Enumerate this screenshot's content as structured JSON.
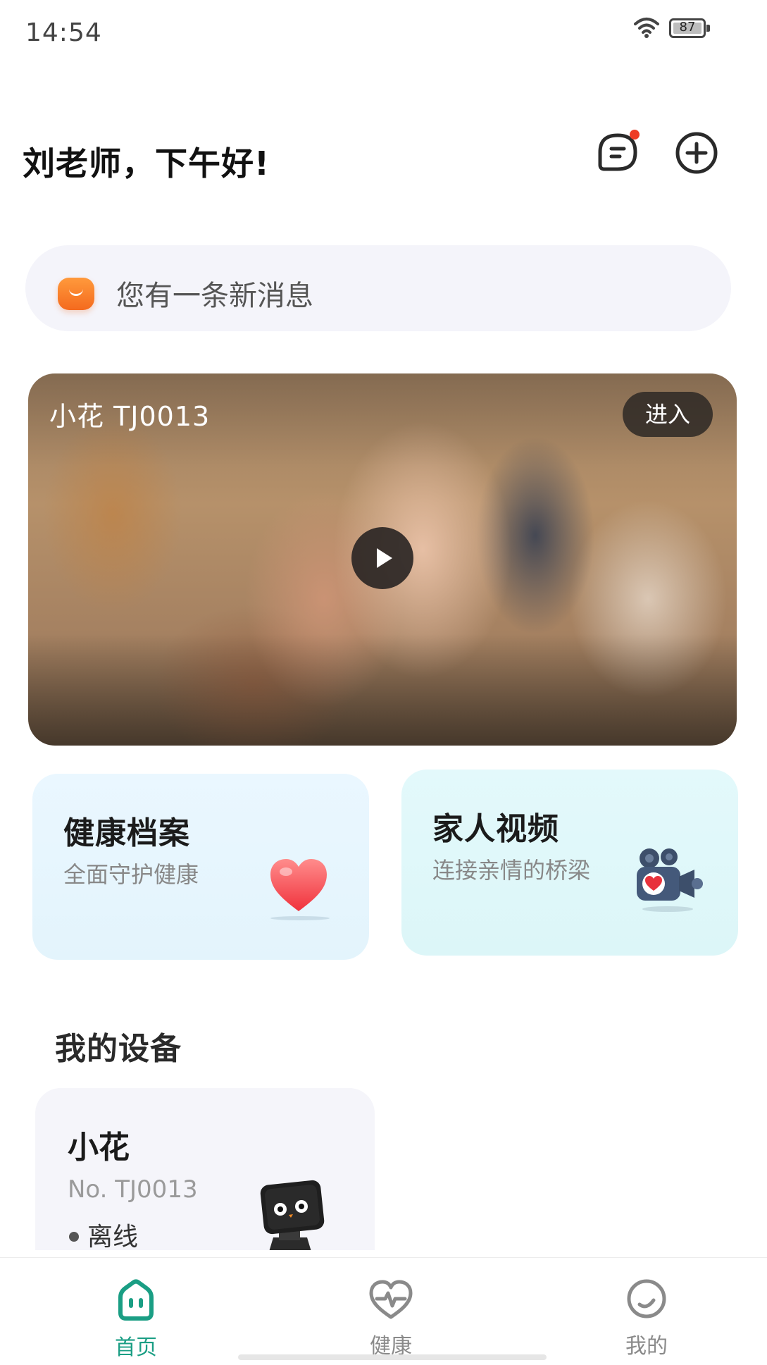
{
  "status_bar": {
    "time": "14:54",
    "battery": "87",
    "icons": [
      "wifi-icon",
      "battery-icon"
    ]
  },
  "header": {
    "greeting": "刘老师，下午好!",
    "message_icon": "message-icon",
    "add_icon": "add-circle-icon",
    "has_unread": true
  },
  "notice": {
    "icon": "smile-icon",
    "text": "您有一条新消息"
  },
  "video": {
    "title": "小花  TJ0013",
    "enter_label": "进入",
    "play_icon": "play-icon"
  },
  "features": [
    {
      "title": "健康档案",
      "subtitle": "全面守护健康",
      "icon": "heart-icon"
    },
    {
      "title": "家人视频",
      "subtitle": "连接亲情的桥梁",
      "icon": "video-camera-icon"
    }
  ],
  "devices_section": {
    "title": "我的设备",
    "devices": [
      {
        "name": "小花",
        "number": "No. TJ0013",
        "status": "离线",
        "icon": "robot-device-icon"
      }
    ]
  },
  "tab_bar": {
    "active": "首页",
    "tabs": [
      {
        "label": "首页",
        "icon": "home-icon"
      },
      {
        "label": "健康",
        "icon": "heart-pulse-icon"
      },
      {
        "label": "我的",
        "icon": "profile-icon"
      }
    ]
  },
  "colors": {
    "accent": "#1a9e84",
    "badge": "#ee3b24",
    "notice_icon": "#f46a1e",
    "health_card": "#eaf7ff",
    "family_card": "#e3f9fb"
  }
}
